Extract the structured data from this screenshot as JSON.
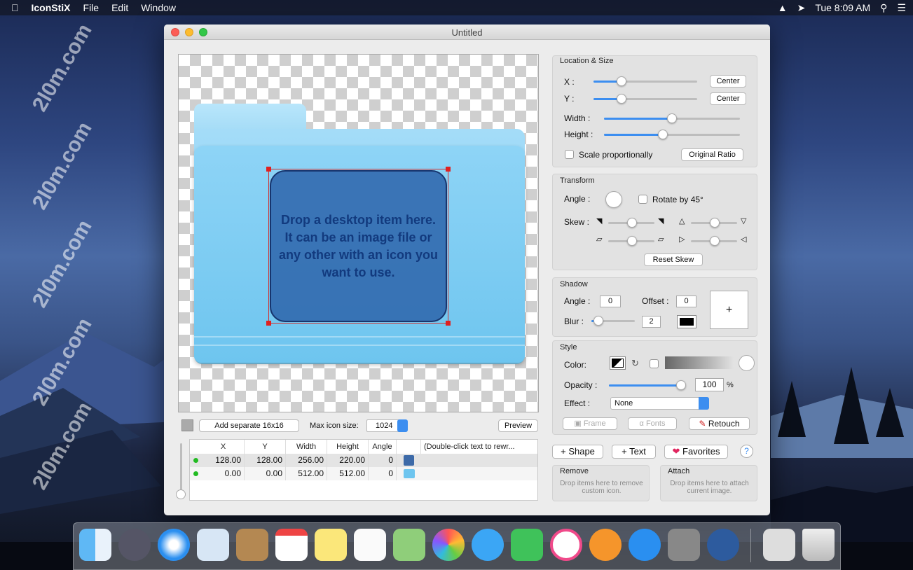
{
  "menubar": {
    "app": "IconStiX",
    "items": [
      "File",
      "Edit",
      "Window"
    ],
    "time": "Tue 8:09 AM"
  },
  "window": {
    "title": "Untitled"
  },
  "canvas": {
    "drop_text": "Drop a desktop item here.\nIt can be an image file or any other with an icon you want to use."
  },
  "toolbar": {
    "add_separate": "Add separate 16x16",
    "max_icon_size_label": "Max icon size:",
    "max_icon_size": "1024",
    "preview": "Preview"
  },
  "table": {
    "headers": [
      "X",
      "Y",
      "Width",
      "Height",
      "Angle",
      "",
      "(Double-click text to rewr..."
    ],
    "rows": [
      {
        "x": "128.00",
        "y": "128.00",
        "width": "256.00",
        "height": "220.00",
        "angle": "0"
      },
      {
        "x": "0.00",
        "y": "0.00",
        "width": "512.00",
        "height": "512.00",
        "angle": "0"
      }
    ]
  },
  "location": {
    "title": "Location & Size",
    "x_label": "X :",
    "y_label": "Y :",
    "center": "Center",
    "width_label": "Width :",
    "height_label": "Height :",
    "scale_label": "Scale proportionally",
    "original_ratio": "Original Ratio"
  },
  "transform": {
    "title": "Transform",
    "angle_label": "Angle :",
    "rotate_label": "Rotate by 45°",
    "skew_label": "Skew :",
    "reset_skew": "Reset Skew"
  },
  "shadow": {
    "title": "Shadow",
    "angle_label": "Angle :",
    "angle": "0",
    "offset_label": "Offset :",
    "offset": "0",
    "blur_label": "Blur :",
    "blur": "2",
    "add": "+"
  },
  "style": {
    "title": "Style",
    "color_label": "Color:",
    "opacity_label": "Opacity :",
    "opacity": "100",
    "percent": "%",
    "effect_label": "Effect :",
    "effect": "None",
    "frame": "Frame",
    "fonts": "Fonts",
    "retouch": "Retouch"
  },
  "actions": {
    "shape": "Shape",
    "text": "Text",
    "favorites": "Favorites",
    "help": "?"
  },
  "remove": {
    "title": "Remove",
    "hint": "Drop items here to remove custom icon."
  },
  "attach": {
    "title": "Attach",
    "hint": "Drop items here to attach current image."
  },
  "watermark": "2l0m.com",
  "colors": {
    "accent": "#3c8ef0",
    "folder": "#7fcdf2",
    "retouch_icon": "#d02020"
  }
}
